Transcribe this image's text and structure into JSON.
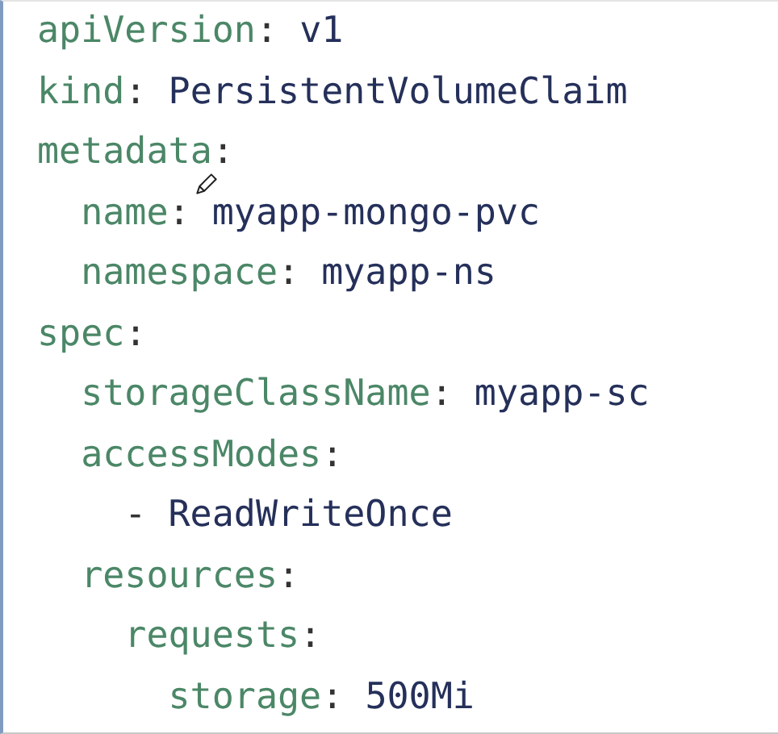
{
  "yaml": [
    {
      "kind": "pair",
      "key": "apiVersion",
      "colon": ":",
      "value": "v1"
    },
    {
      "kind": "pair",
      "key": "kind",
      "colon": ":",
      "value": "PersistentVolumeClaim"
    },
    {
      "kind": "pair",
      "key": "metadata",
      "colon": ":",
      "children": [
        {
          "kind": "pair",
          "key": "name",
          "colon": ":",
          "value": "myapp-mongo-pvc"
        },
        {
          "kind": "pair",
          "key": "namespace",
          "colon": ":",
          "value": "myapp-ns"
        }
      ]
    },
    {
      "kind": "pair",
      "key": "spec",
      "colon": ":",
      "children": [
        {
          "kind": "pair",
          "key": "storageClassName",
          "colon": ":",
          "value": "myapp-sc"
        },
        {
          "kind": "pair",
          "key": "accessModes",
          "colon": ":",
          "children": [
            {
              "kind": "item",
              "marker": "-",
              "value": "ReadWriteOnce"
            }
          ]
        },
        {
          "kind": "pair",
          "key": "resources",
          "colon": ":",
          "children": [
            {
              "kind": "pair",
              "key": "requests",
              "colon": ":",
              "children": [
                {
                  "kind": "pair",
                  "key": "storage",
                  "colon": ":",
                  "value": "500Mi"
                }
              ]
            }
          ]
        }
      ]
    }
  ]
}
